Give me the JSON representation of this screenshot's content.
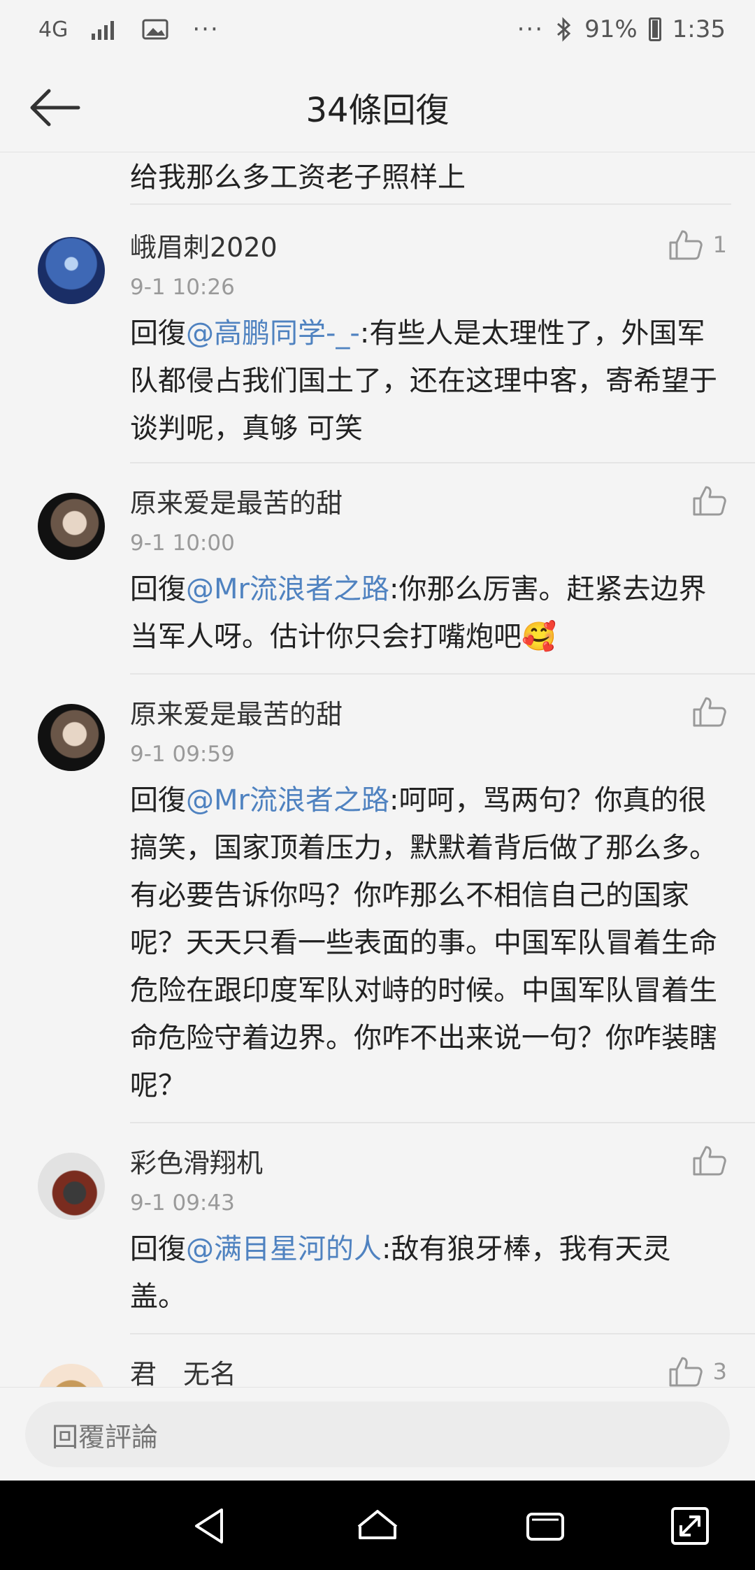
{
  "status_bar": {
    "network": "4G",
    "time": "1:35",
    "battery": "91%",
    "dots_left": "···",
    "dots_right": "···"
  },
  "header": {
    "title": "34條回復"
  },
  "partial_comment": {
    "text": "给我那么多工资老子照样上"
  },
  "comments": [
    {
      "author": "峨眉刺2020",
      "time": "9-1 10:26",
      "likes": "1",
      "prefix": "回復",
      "mention": "@高鹏同学-_-",
      "text": ":有些人是太理性了，外国军队都侵占我们国土了，还在这理中客，寄希望于谈判呢，真够 可笑"
    },
    {
      "author": "原来爱是最苦的甜",
      "time": "9-1 10:00",
      "likes": "",
      "prefix": "回復",
      "mention": "@Mr流浪者之路",
      "text": ":你那么厉害。赶紧去边界当军人呀。估计你只会打嘴炮吧🥰"
    },
    {
      "author": "原来爱是最苦的甜",
      "time": "9-1 09:59",
      "likes": "",
      "prefix": "回復",
      "mention": "@Mr流浪者之路",
      "text": ":呵呵，骂两句？你真的很搞笑，国家顶着压力，默默着背后做了那么多。有必要告诉你吗？你咋那么不相信自己的国家呢？天天只看一些表面的事。中国军队冒着生命危险在跟印度军队对峙的时候。中国军队冒着生命危险守着边界。你咋不出来说一句？你咋装瞎呢？"
    },
    {
      "author": "彩色滑翔机",
      "time": "9-1 09:43",
      "likes": "",
      "prefix": "回復",
      "mention": "@满目星河的人",
      "text": ":敌有狼牙棒，我有天灵盖。"
    },
    {
      "author": "君__无名",
      "time": "",
      "likes": "3",
      "prefix": "",
      "mention": "",
      "text": ""
    }
  ],
  "input": {
    "placeholder": "回覆評論"
  },
  "icons": {
    "back": "arrow-left-icon",
    "like": "thumbs-up-icon",
    "nav_back": "triangle-back-icon",
    "nav_home": "home-icon",
    "nav_recent": "recent-apps-icon",
    "nav_expand": "expand-icon"
  },
  "colors": {
    "mention": "#4f82c0",
    "background": "#f4f4f4"
  }
}
